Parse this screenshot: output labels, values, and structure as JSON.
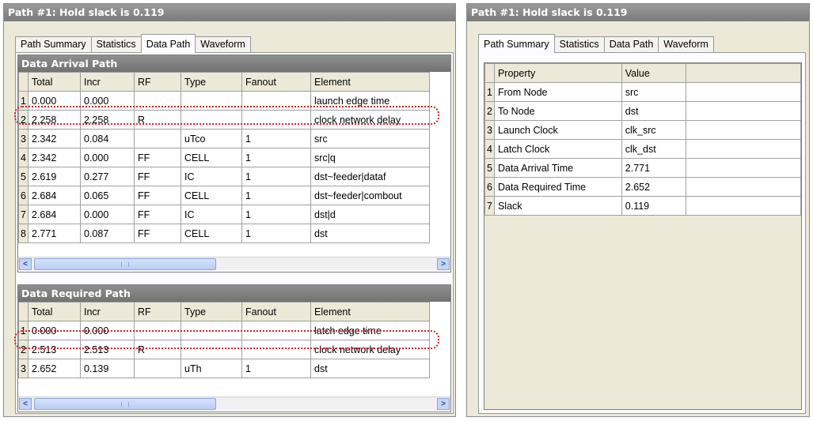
{
  "left": {
    "title": "Path #1: Hold slack is 0.119",
    "tabs": [
      "Path Summary",
      "Statistics",
      "Data Path",
      "Waveform"
    ],
    "arrival": {
      "title": "Data Arrival Path",
      "headers": [
        "Total",
        "Incr",
        "RF",
        "Type",
        "Fanout",
        "Element"
      ],
      "rows": [
        [
          "1",
          "0.000",
          "0.000",
          "",
          "",
          "",
          "launch edge time"
        ],
        [
          "2",
          "2.258",
          "2.258",
          "R",
          "",
          "",
          "clock network delay"
        ],
        [
          "3",
          "2.342",
          "0.084",
          "",
          "uTco",
          "1",
          "src"
        ],
        [
          "4",
          "2.342",
          "0.000",
          "FF",
          "CELL",
          "1",
          "src|q"
        ],
        [
          "5",
          "2.619",
          "0.277",
          "FF",
          "IC",
          "1",
          "dst~feeder|dataf"
        ],
        [
          "6",
          "2.684",
          "0.065",
          "FF",
          "CELL",
          "1",
          "dst~feeder|combout"
        ],
        [
          "7",
          "2.684",
          "0.000",
          "FF",
          "IC",
          "1",
          "dst|d"
        ],
        [
          "8",
          "2.771",
          "0.087",
          "FF",
          "CELL",
          "1",
          "dst"
        ]
      ]
    },
    "required": {
      "title": "Data Required Path",
      "headers": [
        "Total",
        "Incr",
        "RF",
        "Type",
        "Fanout",
        "Element"
      ],
      "rows": [
        [
          "1",
          "0.000",
          "0.000",
          "",
          "",
          "",
          "latch edge time"
        ],
        [
          "2",
          "2.513",
          "2.513",
          "R",
          "",
          "",
          "clock network delay"
        ],
        [
          "3",
          "2.652",
          "0.139",
          "",
          "uTh",
          "1",
          "dst"
        ]
      ]
    }
  },
  "right": {
    "title": "Path #1: Hold slack is 0.119",
    "tabs": [
      "Path Summary",
      "Statistics",
      "Data Path",
      "Waveform"
    ],
    "headers": [
      "Property",
      "Value"
    ],
    "rows": [
      [
        "1",
        "From Node",
        "src"
      ],
      [
        "2",
        "To Node",
        "dst"
      ],
      [
        "3",
        "Launch Clock",
        "clk_src"
      ],
      [
        "4",
        "Latch Clock",
        "clk_dst"
      ],
      [
        "5",
        "Data Arrival Time",
        "2.771"
      ],
      [
        "6",
        "Data Required Time",
        "2.652"
      ],
      [
        "7",
        "Slack",
        "0.119"
      ]
    ]
  },
  "scroll": {
    "left_arrow": "<",
    "right_arrow": ">"
  },
  "colors": {
    "highlight": "#d0202a",
    "title_bar": "#8a8a8a"
  }
}
